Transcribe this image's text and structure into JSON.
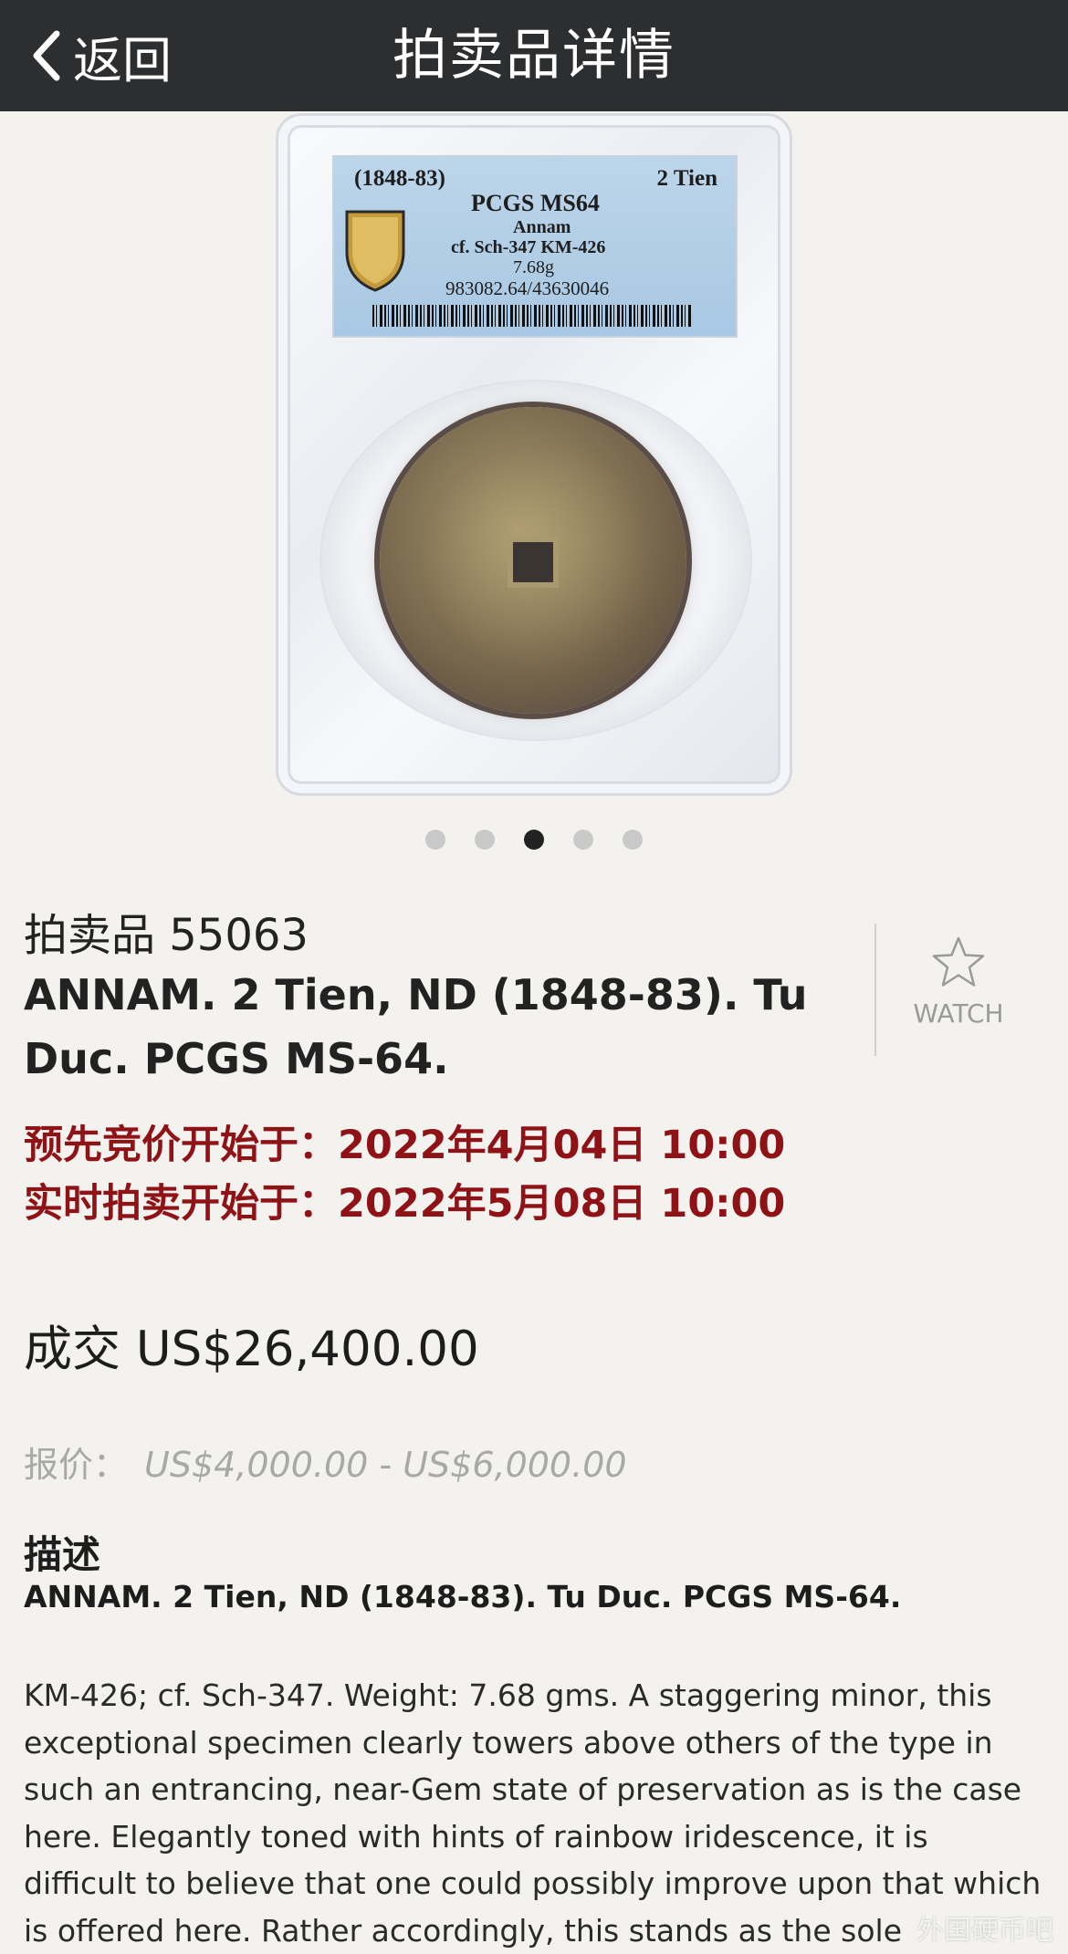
{
  "header": {
    "back_label": "返回",
    "title": "拍卖品详情"
  },
  "slab": {
    "date": "(1848-83)",
    "denomination": "2 Tien",
    "grade": "PCGS MS64",
    "region": "Annam",
    "catalog": "cf. Sch-347 KM-426",
    "weight": "7.68g",
    "cert": "983082.64/43630046",
    "logo_text": "PCGS"
  },
  "carousel": {
    "count": 5,
    "active_index": 2
  },
  "lot": {
    "number": "拍卖品 55063",
    "title": "ANNAM. 2 Tien, ND (1848-83). Tu Duc. PCGS MS-64.",
    "watch_label": "WATCH",
    "prebid_start": "预先竞价开始于：2022年4月04日 10:00",
    "live_start": "实时拍卖开始于：2022年5月08日 10:00",
    "sold": "成交 US$26,400.00",
    "estimate_label": "报价：",
    "estimate_value": "US$4,000.00 - US$6,000.00"
  },
  "description": {
    "heading": "描述",
    "title": "ANNAM. 2 Tien, ND (1848-83). Tu Duc. PCGS MS-64.",
    "body": "KM-426; cf. Sch-347. Weight: 7.68 gms. A staggering minor, this exceptional specimen clearly towers above others of the type in such an entrancing, near-Gem state of preservation as is the case here. Elegantly toned with hints of rainbow iridescence, it is difficult to believe that one could possibly improve upon that which is offered here. Rather accordingly, this stands as the sole"
  },
  "watermark": "外国硬币吧",
  "colors": {
    "header_bg": "#2c2e2f",
    "page_bg": "#f3f2ee",
    "date_red": "#8e1216",
    "muted_gray": "#a8a8a8"
  }
}
